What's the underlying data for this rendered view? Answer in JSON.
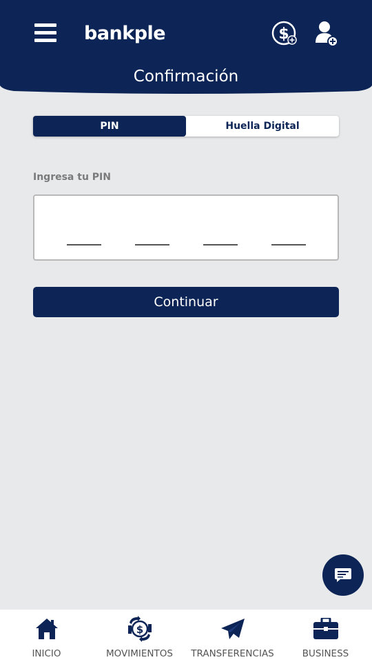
{
  "colors": {
    "primary": "#0d2556",
    "background": "#e8e9eb",
    "white": "#ffffff"
  },
  "header": {
    "logo_text": "bankple",
    "title": "Confirmación",
    "menu_icon": "hamburger-menu-icon",
    "right_icons": [
      "dollar-add-icon",
      "user-add-icon"
    ]
  },
  "auth_tabs": {
    "selected": "PIN",
    "items": [
      "PIN",
      "Huella Digital"
    ]
  },
  "pin": {
    "label": "Ingresa tu PIN",
    "slot_values": [
      "",
      "",
      "",
      ""
    ]
  },
  "continue_label": "Continuar",
  "chat_icon": "chat-bubble-icon",
  "bottom_nav": {
    "items": [
      {
        "label": "INICIO",
        "icon": "home-icon"
      },
      {
        "label": "MOVIMIENTOS",
        "icon": "money-exchange-icon"
      },
      {
        "label": "TRANSFERENCIAS",
        "icon": "paper-plane-icon"
      },
      {
        "label": "BUSINESS",
        "icon": "briefcase-icon"
      }
    ]
  }
}
